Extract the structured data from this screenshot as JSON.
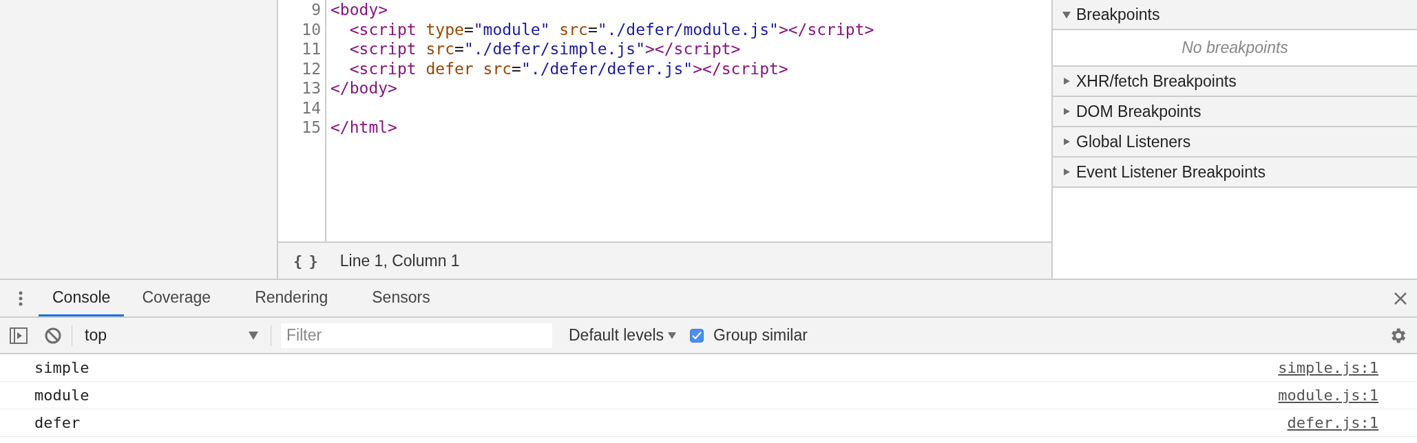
{
  "editor": {
    "lines": [
      {
        "number": "9",
        "tokens": [
          {
            "kind": "tag",
            "text": "<body>"
          }
        ]
      },
      {
        "number": "10",
        "tokens": [
          {
            "kind": "tag",
            "text": "  <script "
          },
          {
            "kind": "attr",
            "text": "type"
          },
          {
            "kind": "plain",
            "text": "="
          },
          {
            "kind": "value",
            "text": "\"module\" "
          },
          {
            "kind": "attr",
            "text": "src"
          },
          {
            "kind": "plain",
            "text": "="
          },
          {
            "kind": "value",
            "text": "\"./defer/module.js\""
          },
          {
            "kind": "tag",
            "text": "></script>"
          }
        ]
      },
      {
        "number": "11",
        "tokens": [
          {
            "kind": "tag",
            "text": "  <script "
          },
          {
            "kind": "attr",
            "text": "src"
          },
          {
            "kind": "plain",
            "text": "="
          },
          {
            "kind": "value",
            "text": "\"./defer/simple.js\""
          },
          {
            "kind": "tag",
            "text": "></script>"
          }
        ]
      },
      {
        "number": "12",
        "tokens": [
          {
            "kind": "tag",
            "text": "  <script "
          },
          {
            "kind": "attr",
            "text": "defer src"
          },
          {
            "kind": "plain",
            "text": "="
          },
          {
            "kind": "value",
            "text": "\"./defer/defer.js\""
          },
          {
            "kind": "tag",
            "text": "></script>"
          }
        ]
      },
      {
        "number": "13",
        "tokens": [
          {
            "kind": "tag",
            "text": "</body>"
          }
        ]
      },
      {
        "number": "14"
      },
      {
        "number": "15",
        "tokens": [
          {
            "kind": "tag",
            "text": "</html>"
          }
        ]
      }
    ],
    "status_bar": {
      "format_button": "{ }",
      "position": "Line 1, Column 1"
    }
  },
  "sidebar": {
    "sections": [
      {
        "title": "Breakpoints",
        "expanded": true,
        "empty_text": "No breakpoints"
      },
      {
        "title": "XHR/fetch Breakpoints",
        "expanded": false
      },
      {
        "title": "DOM Breakpoints",
        "expanded": false
      },
      {
        "title": "Global Listeners",
        "expanded": false
      },
      {
        "title": "Event Listener Breakpoints",
        "expanded": false
      }
    ]
  },
  "drawer": {
    "tabs": [
      {
        "label": "Console",
        "selected": true
      },
      {
        "label": "Coverage",
        "selected": false
      },
      {
        "label": "Rendering",
        "selected": false
      },
      {
        "label": "Sensors",
        "selected": false
      }
    ],
    "toolbar": {
      "context": "top",
      "filter_placeholder": "Filter",
      "levels": "Default levels",
      "group_similar": {
        "label": "Group similar",
        "checked": true
      }
    },
    "messages": [
      {
        "text": "simple",
        "source": "simple.js:1"
      },
      {
        "text": "module",
        "source": "module.js:1"
      },
      {
        "text": "defer",
        "source": "defer.js:1"
      }
    ]
  }
}
